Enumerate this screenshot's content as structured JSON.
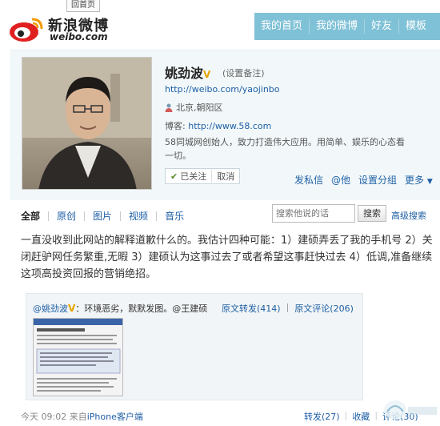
{
  "header": {
    "back_home": "回首页",
    "logo_cn": "新浪微博",
    "logo_en": "weibo.com",
    "nav": [
      "我的首页",
      "我的微博",
      "好友",
      "模板"
    ]
  },
  "profile": {
    "name": "姚劲波",
    "verified_mark": "V",
    "remark": "(设置备注)",
    "url": "http://weibo.com/yaojinbo",
    "location": "北京,朝阳区",
    "blog_label": "博客:",
    "blog_url": "http://www.58.com",
    "bio": "58同城网创始人，致力打造伟大应用。用简单、娱乐的心态看一切。",
    "followed": "已关注",
    "cancel": "取消",
    "actions": [
      "发私信",
      "@他",
      "设置分组",
      "更多"
    ]
  },
  "tabs": [
    "全部",
    "原创",
    "图片",
    "视频",
    "音乐"
  ],
  "search": {
    "placeholder": "搜索他说的话",
    "button": "搜索",
    "advanced": "高级搜索"
  },
  "post": {
    "text": "一直没收到此网站的解释道歉什么的。我估计四种可能：1）建硕弄丢了我的手机号 2）关闭赶驴网任务繁重,无暇 3）建硕认为这事过去了或者希望这事赶快过去 4）低调,准备继续这项高投资回报的营销绝招。",
    "repost_author": "@姚劲波",
    "repost_verified": "V",
    "repost_text": "：环境恶劣，默默发图。@王建硕",
    "repost_forward": "原文转发(414)",
    "repost_comment": "原文评论(206)",
    "time": "今天 09:02",
    "source_prefix": "来自",
    "source": "iPhone客户端",
    "forward": "转发(27)",
    "favorite": "收藏",
    "comment": "评论(30)"
  },
  "colors": {
    "nav_bg": "#7fc1d6",
    "link": "#1e5fa5",
    "profile_bg": "#f2f8fa"
  }
}
